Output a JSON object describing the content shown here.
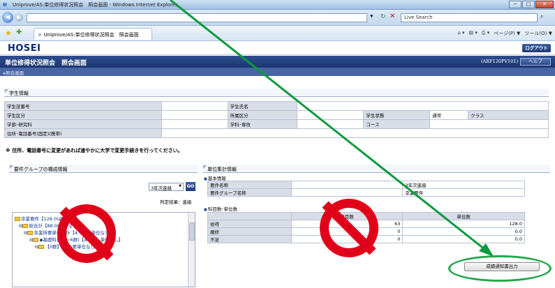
{
  "window": {
    "title": "Uniprove/AS:単位修得状況照会　照会画面 - Windows Internet Explorer",
    "min_glyph": "─",
    "max_glyph": "□",
    "close_glyph": "✕"
  },
  "browser": {
    "search_placeholder": "Live Search",
    "tab_title": "Uniprove/AS:単位修得状況照会　照会画面",
    "commands": [
      "ページ(P) ▼",
      "ツール(O) ▼"
    ]
  },
  "app": {
    "logo": "HOSEI",
    "logout_label": "ログアウト",
    "page_title": "単位修得状況照会　照会画面",
    "screen_id": "(ARF120PV101)",
    "help_label": "ヘルプ",
    "breadcrumb": "▸照会画面"
  },
  "student": {
    "section_title": "学生情報",
    "labels": {
      "student_no": "学生証番号",
      "student_name": "学生氏名",
      "student_type": "学生区分",
      "affiliation": "所属区分",
      "status": "学生状態",
      "class": "クラス",
      "faculty": "学部･研究科",
      "department": "学科･専攻",
      "course": "コース",
      "address": "住所･電話番号(固定)(携帯)"
    },
    "values": {
      "status": "通常"
    },
    "notice": "※ 住所、電話番号に変更があれば速やかに大学で変更手続きを行ってください。"
  },
  "requirement_group": {
    "section_title": "要件グループの構成情報",
    "selected_group": "3年次進級",
    "go_label": "GO",
    "judge_result": "判定結果：進級",
    "tree": [
      "卒業要件【128.0(必修:…)】",
      "総合計【88.0(必…)】",
      "卒業所要単位合計【4…条件単位なし】",
      "◆基礎科目(1～6群)【48.0(…単位なし】",
      "【0群】(…必要単位なし)"
    ]
  },
  "credit_summary": {
    "section_title": "単位集計情報",
    "basic_title": "基本情報",
    "rows": [
      {
        "label": "要件名称",
        "value": "3年次進級"
      },
      {
        "label": "要件グループ名称",
        "value": "卒業要件"
      }
    ],
    "counts_title": "科目数･単位数",
    "headers": [
      "",
      "科目数",
      "単位数"
    ],
    "counts": [
      {
        "label": "修得",
        "courses": "63",
        "credits": "128.0"
      },
      {
        "label": "履修",
        "courses": "0",
        "credits": "0.0"
      },
      {
        "label": "不足",
        "courses": "0",
        "credits": "0.0"
      }
    ],
    "report_button": "成績通知書出力"
  },
  "annotation_colors": {
    "prohibit": "#e1001a",
    "highlight": "#23a64a"
  }
}
